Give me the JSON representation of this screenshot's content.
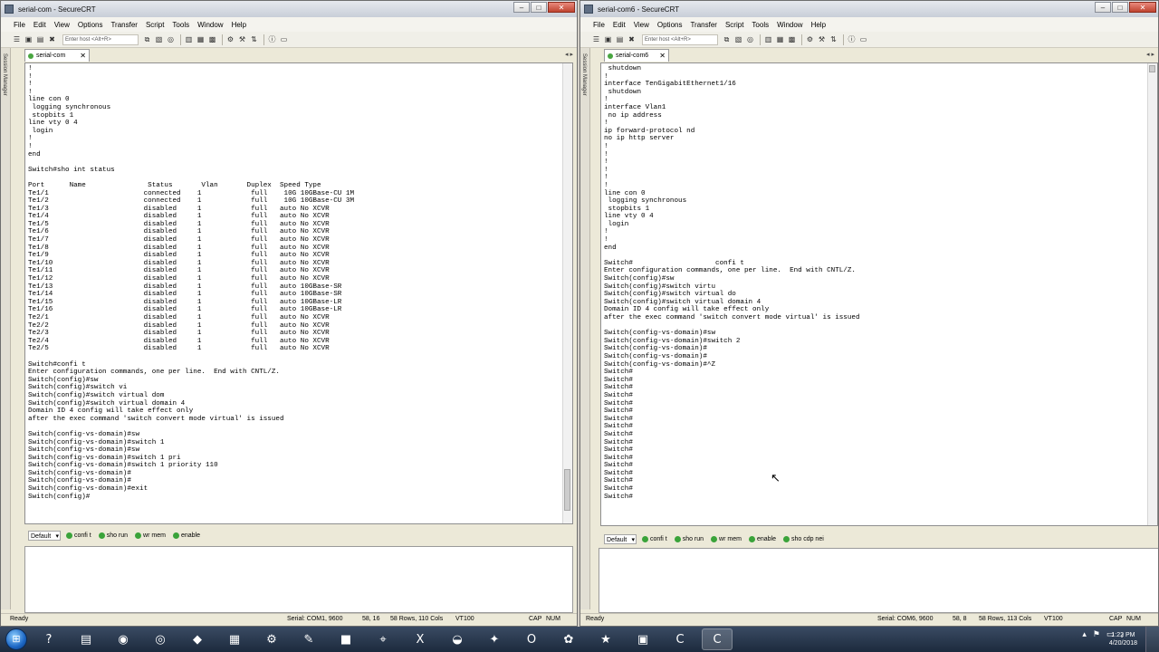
{
  "left_window": {
    "title": "serial-com - SecureCRT",
    "controls": [
      "–",
      "□",
      "✕"
    ],
    "menu": [
      "File",
      "Edit",
      "View",
      "Options",
      "Transfer",
      "Script",
      "Tools",
      "Window",
      "Help"
    ],
    "toolbar_input_placeholder": "Enter host <Alt+R>",
    "session_manager_label": "Session Manager",
    "tab_label": "serial-com",
    "tab_nav": "◂ ▸",
    "terminal_lines": [
      "!",
      "!",
      "!",
      "!",
      "line con 0",
      " logging synchronous",
      " stopbits 1",
      "line vty 0 4",
      " login",
      "!",
      "!",
      "end",
      "",
      "Switch#sho int status",
      "",
      "Port      Name               Status       Vlan       Duplex  Speed Type",
      "Te1/1                       connected    1            full    10G 10GBase-CU 1M",
      "Te1/2                       connected    1            full    10G 10GBase-CU 3M",
      "Te1/3                       disabled     1            full   auto No XCVR",
      "Te1/4                       disabled     1            full   auto No XCVR",
      "Te1/5                       disabled     1            full   auto No XCVR",
      "Te1/6                       disabled     1            full   auto No XCVR",
      "Te1/7                       disabled     1            full   auto No XCVR",
      "Te1/8                       disabled     1            full   auto No XCVR",
      "Te1/9                       disabled     1            full   auto No XCVR",
      "Te1/10                      disabled     1            full   auto No XCVR",
      "Te1/11                      disabled     1            full   auto No XCVR",
      "Te1/12                      disabled     1            full   auto No XCVR",
      "Te1/13                      disabled     1            full   auto 10GBase-SR",
      "Te1/14                      disabled     1            full   auto 10GBase-SR",
      "Te1/15                      disabled     1            full   auto 10GBase-LR",
      "Te1/16                      disabled     1            full   auto 10GBase-LR",
      "Te2/1                       disabled     1            full   auto No XCVR",
      "Te2/2                       disabled     1            full   auto No XCVR",
      "Te2/3                       disabled     1            full   auto No XCVR",
      "Te2/4                       disabled     1            full   auto No XCVR",
      "Te2/5                       disabled     1            full   auto No XCVR",
      "",
      "Switch#confi t",
      "Enter configuration commands, one per line.  End with CNTL/Z.",
      "Switch(config)#sw",
      "Switch(config)#switch vi",
      "Switch(config)#switch virtual dom",
      "Switch(config)#switch virtual domain 4",
      "Domain ID 4 config will take effect only",
      "after the exec command 'switch convert mode virtual' is issued",
      "",
      "Switch(config-vs-domain)#sw",
      "Switch(config-vs-domain)#switch 1",
      "Switch(config-vs-domain)#sw",
      "Switch(config-vs-domain)#switch 1 pri",
      "Switch(config-vs-domain)#switch 1 priority 110",
      "Switch(config-vs-domain)#",
      "Switch(config-vs-domain)#",
      "Switch(config-vs-domain)#exit",
      "Switch(config)#"
    ],
    "button_bar": {
      "combo": "Default",
      "buttons": [
        "confi t",
        "sho run",
        "wr mem",
        "enable"
      ]
    },
    "status": {
      "left": "Ready",
      "serial": "Serial: COM1, 9600",
      "position": "58, 16",
      "size": "58 Rows, 110 Cols",
      "emulation": "VT100",
      "cap": "CAP",
      "num": "NUM"
    }
  },
  "right_window": {
    "title": "serial-com6 - SecureCRT",
    "controls": [
      "–",
      "□",
      "✕"
    ],
    "menu": [
      "File",
      "Edit",
      "View",
      "Options",
      "Transfer",
      "Script",
      "Tools",
      "Window",
      "Help"
    ],
    "toolbar_input_placeholder": "Enter host <Alt+R>",
    "session_manager_label": "Session Manager",
    "tab_label": "serial-com6",
    "tab_nav": "◂ ▸",
    "terminal_lines": [
      " shutdown",
      "!",
      "interface TenGigabitEthernet1/16",
      " shutdown",
      "!",
      "interface Vlan1",
      " no ip address",
      "!",
      "ip forward-protocol nd",
      "no ip http server",
      "!",
      "!",
      "!",
      "!",
      "!",
      "!",
      "line con 0",
      " logging synchronous",
      " stopbits 1",
      "line vty 0 4",
      " login",
      "!",
      "!",
      "end",
      "",
      "Switch#                    confi t",
      "Enter configuration commands, one per line.  End with CNTL/Z.",
      "Switch(config)#sw",
      "Switch(config)#switch virtu",
      "Switch(config)#switch virtual do",
      "Switch(config)#switch virtual domain 4",
      "Domain ID 4 config will take effect only",
      "after the exec command 'switch convert mode virtual' is issued",
      "",
      "Switch(config-vs-domain)#sw",
      "Switch(config-vs-domain)#switch 2",
      "Switch(config-vs-domain)#",
      "Switch(config-vs-domain)#",
      "Switch(config-vs-domain)#^Z",
      "Switch#",
      "Switch#",
      "Switch#",
      "Switch#",
      "Switch#",
      "Switch#",
      "Switch#",
      "Switch#",
      "Switch#",
      "Switch#",
      "Switch#",
      "Switch#",
      "Switch#",
      "Switch#",
      "Switch#",
      "Switch#",
      "Switch#"
    ],
    "button_bar": {
      "combo": "Default",
      "buttons": [
        "confi t",
        "sho run",
        "wr mem",
        "enable",
        "sho cdp nei"
      ]
    },
    "status": {
      "left": "Ready",
      "serial": "Serial: COM6, 9600",
      "position": "58, 8",
      "size": "58 Rows, 113 Cols",
      "emulation": "VT100",
      "cap": "CAP",
      "num": "NUM"
    }
  },
  "mouse_cursor": "↖",
  "taskbar": {
    "start_glyph": "⊞",
    "apps": [
      {
        "name": "help-icon",
        "glyph": "?"
      },
      {
        "name": "explorer-icon",
        "glyph": "▤"
      },
      {
        "name": "firefox-icon",
        "glyph": "◉"
      },
      {
        "name": "chrome-icon",
        "glyph": "◎"
      },
      {
        "name": "securecrt-icon",
        "glyph": "◆"
      },
      {
        "name": "calculator-icon",
        "glyph": "▦"
      },
      {
        "name": "network-tool-icon",
        "glyph": "⚙"
      },
      {
        "name": "notes-icon",
        "glyph": "✎"
      },
      {
        "name": "terminal-icon",
        "glyph": "■"
      },
      {
        "name": "putty-icon",
        "glyph": "⌖"
      },
      {
        "name": "excel-icon",
        "glyph": "X"
      },
      {
        "name": "vpn-icon",
        "glyph": "◒"
      },
      {
        "name": "tools-icon",
        "glyph": "✦"
      },
      {
        "name": "outlook-icon",
        "glyph": "O"
      },
      {
        "name": "paint-icon",
        "glyph": "✿"
      },
      {
        "name": "system-icon",
        "glyph": "★"
      },
      {
        "name": "monitor-icon",
        "glyph": "▣"
      },
      {
        "name": "camtasia-icon",
        "glyph": "C"
      },
      {
        "name": "crt-icon",
        "glyph": "C"
      }
    ],
    "active_index": 18,
    "tray": [
      "▴",
      "⚑",
      "▭",
      "♪"
    ],
    "clock_time": "1:22 PM",
    "clock_date": "4/20/2018"
  }
}
